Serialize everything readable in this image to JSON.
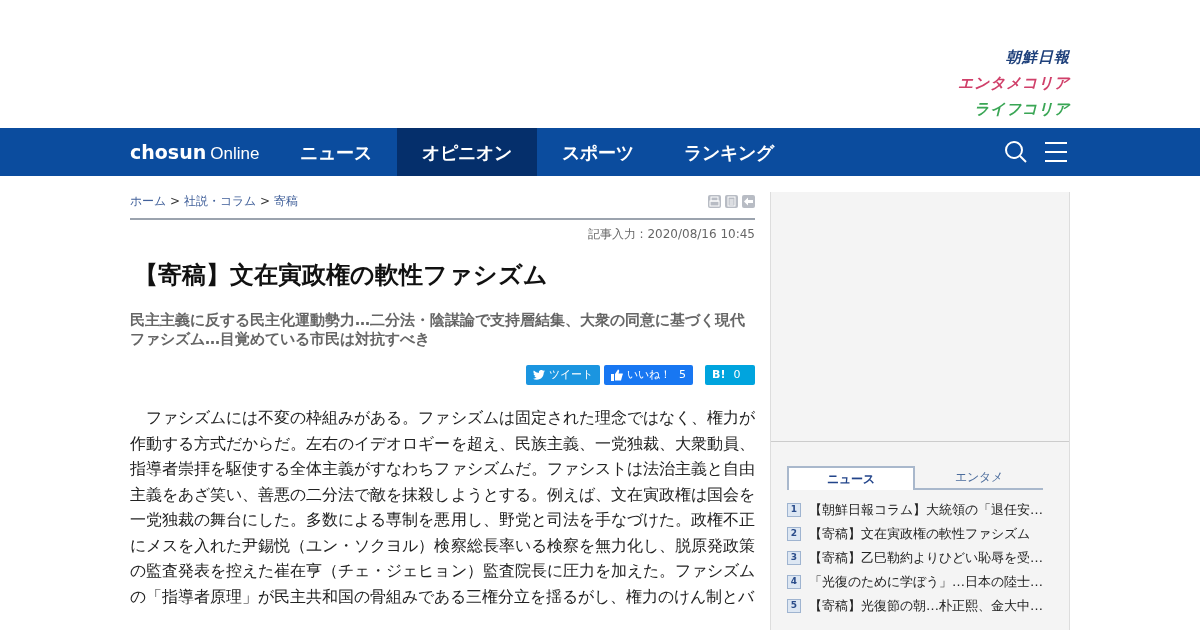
{
  "header": {
    "logos": [
      {
        "text": "朝鮮日報",
        "color": "#1d3f7a"
      },
      {
        "text": "エンタメコリア",
        "color": "#d0406a"
      },
      {
        "text": "ライフコリア",
        "color": "#3aa655"
      }
    ]
  },
  "nav": {
    "brand": {
      "main": "chosun",
      "sub": "Online"
    },
    "items": [
      {
        "label": "ニュース",
        "selected": false
      },
      {
        "label": "オピニオン",
        "selected": true
      },
      {
        "label": "スポーツ",
        "selected": false
      },
      {
        "label": "ランキング",
        "selected": false
      }
    ]
  },
  "breadcrumb": [
    {
      "kind": "link",
      "text": "ホーム"
    },
    {
      "kind": "sep",
      "text": ">"
    },
    {
      "kind": "link",
      "text": "社説・コラム"
    },
    {
      "kind": "sep",
      "text": ">"
    },
    {
      "kind": "link",
      "text": "寄稿"
    }
  ],
  "article": {
    "date": "記事入力 : 2020/08/16 10:45",
    "title": "【寄稿】文在寅政権の軟性ファシズム",
    "subtitle": "民主主義に反する民主化運動勢力…二分法・陰謀論で支持層結集、大衆の同意に基づく現代ファシズム…目覚めている市民は対抗すべき",
    "share": [
      {
        "kind": "tweet",
        "label": "ツイート"
      },
      {
        "kind": "like",
        "label": "いいね！",
        "count": "5"
      },
      {
        "kind": "hatena",
        "label": "B!",
        "count": "0"
      }
    ],
    "body": "ファシズムには不変の枠組みがある。ファシズムは固定された理念ではなく、権力が作動する方式だからだ。左右のイデオロギーを超え、民族主義、一党独裁、大衆動員、指導者崇拝を駆使する全体主義がすなわちファシズムだ。ファシストは法治主義と自由主義をあざ笑い、善悪の二分法で敵を抹殺しようとする。例えば、文在寅政権は国会を一党独裁の舞台にした。多数による専制を悪用し、野党と司法を手なづけた。政権不正にメスを入れた尹錫悦（ユン・ソクヨル）検察総長率いる検察を無力化し、脱原発政策の監査発表を控えた崔在亨（チェ・ジェヒョン）監査院長に圧力を加えた。ファシズムの「指導者原理」が民主共和国の骨組みである三権分立を揺るがし、権力のけん制とバ"
  },
  "sidebar": {
    "tabs": [
      {
        "label": "ニュース",
        "selected": true
      },
      {
        "label": "エンタメ",
        "selected": false
      }
    ],
    "ranking": [
      {
        "rank": "1",
        "title": "【朝鮮日報コラム】大統領の「退任安…"
      },
      {
        "rank": "2",
        "title": "【寄稿】文在寅政権の軟性ファシズム"
      },
      {
        "rank": "3",
        "title": "【寄稿】乙巳勒約よりひどい恥辱を受…"
      },
      {
        "rank": "4",
        "title": "「光復のために学ぼう」…日本の陸士…"
      },
      {
        "rank": "5",
        "title": "【寄稿】光復節の朝…朴正熙、金大中…"
      }
    ]
  }
}
